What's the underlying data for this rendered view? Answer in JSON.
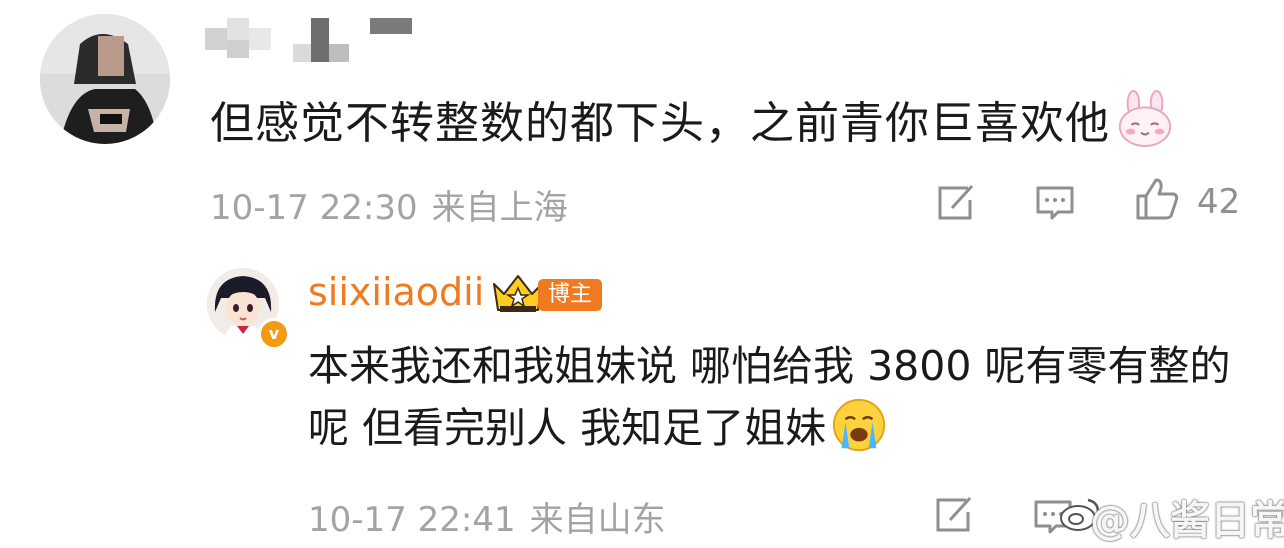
{
  "comment": {
    "text": "但感觉不转整数的都下头，之前青你巨喜欢他",
    "time": "10-17 22:30",
    "location": "来自上海",
    "like_count": "42",
    "emoji": "bunny-shy-emoji"
  },
  "reply": {
    "username": "siixiiaodii",
    "badge": "博主",
    "verified_mark": "v",
    "text": "本来我还和我姐妹说 哪怕给我 3800 呢有零有整的呢 但看完别人 我知足了姐妹",
    "time": "10-17 22:41",
    "location": "来自山东",
    "emoji": "crying-face-emoji"
  },
  "watermark": {
    "text": "@八酱日常"
  },
  "colors": {
    "username": "#f07a1f",
    "badge_bg": "#f07a1f",
    "meta_text": "#a3a3a3"
  }
}
